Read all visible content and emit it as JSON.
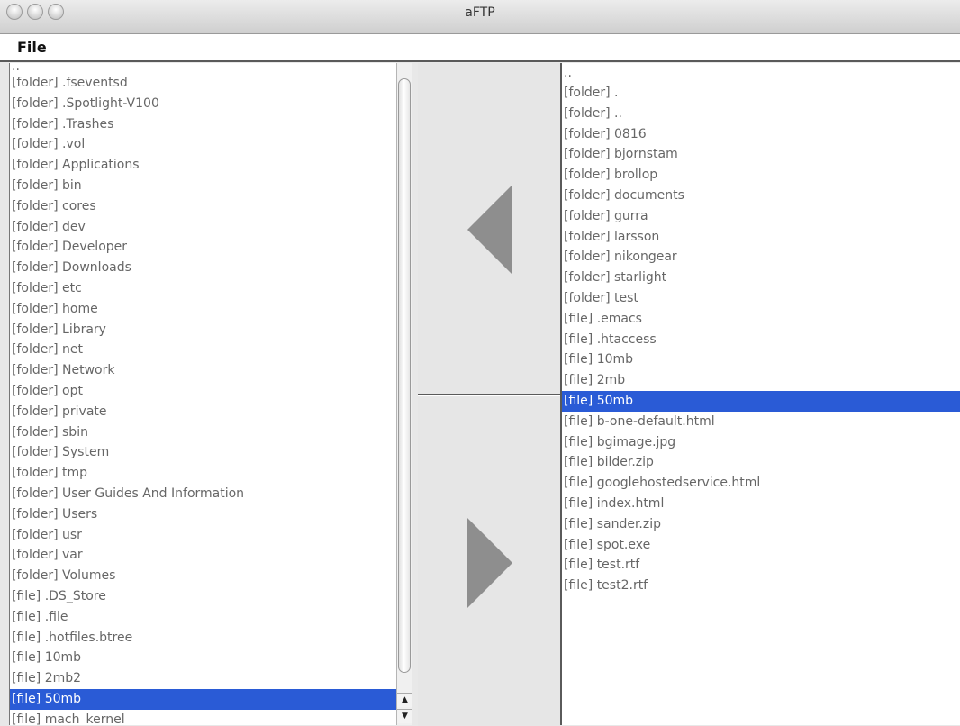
{
  "window": {
    "title": "aFTP"
  },
  "menu": {
    "file": "File"
  },
  "left_list": {
    "items": [
      "..",
      "[folder] .fseventsd",
      "[folder] .Spotlight-V100",
      "[folder] .Trashes",
      "[folder] .vol",
      "[folder] Applications",
      "[folder] bin",
      "[folder] cores",
      "[folder] dev",
      "[folder] Developer",
      "[folder] Downloads",
      "[folder] etc",
      "[folder] home",
      "[folder] Library",
      "[folder] net",
      "[folder] Network",
      "[folder] opt",
      "[folder] private",
      "[folder] sbin",
      "[folder] System",
      "[folder] tmp",
      "[folder] User Guides And Information",
      "[folder] Users",
      "[folder] usr",
      "[folder] var",
      "[folder] Volumes",
      "[file] .DS_Store",
      "[file] .file",
      "[file] .hotfiles.btree",
      "[file] 10mb",
      "[file] 2mb2",
      "[file] 50mb",
      "[file] mach_kernel"
    ],
    "selected_index": 31
  },
  "right_list": {
    "items": [
      "..",
      "[folder] .",
      "[folder] ..",
      "[folder] 0816",
      "[folder] bjornstam",
      "[folder] brollop",
      "[folder] documents",
      "[folder] gurra",
      "[folder] larsson",
      "[folder] nikongear",
      "[folder] starlight",
      "[folder] test",
      "[file] .emacs",
      "[file] .htaccess",
      "[file] 10mb",
      "[file] 2mb",
      "[file] 50mb",
      "[file] b-one-default.html",
      "[file] bgimage.jpg",
      "[file] bilder.zip",
      "[file] googlehostedservice.html",
      "[file] index.html",
      "[file] sander.zip",
      "[file] spot.exe",
      "[file] test.rtf",
      "[file] test2.rtf"
    ],
    "selected_index": 16
  },
  "icons": {
    "download": "arrow-left-icon",
    "upload": "arrow-right-icon"
  },
  "colors": {
    "selection": "#2a5bd6",
    "arrow": "#8e8e8e"
  }
}
